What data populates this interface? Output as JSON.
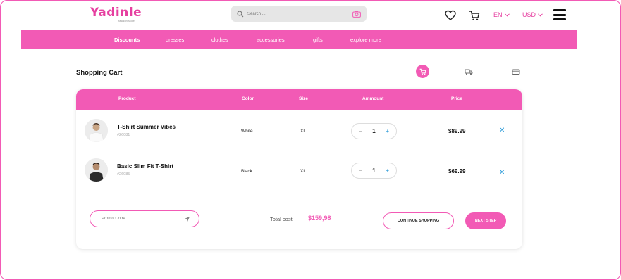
{
  "header": {
    "logo_text": "Yadinle",
    "logo_tagline": "fashion store",
    "search_placeholder": "Search ...",
    "language": "EN",
    "currency": "USD"
  },
  "nav": {
    "items": [
      "Discounts",
      "dresses",
      "clothes",
      "accessories",
      "gifts",
      "explore  more"
    ]
  },
  "page": {
    "title": "Shopping Cart"
  },
  "table": {
    "columns": [
      "Product",
      "Color",
      "Size",
      "Ammount",
      "Price"
    ],
    "rows": [
      {
        "name": "T-Shirt Summer Vibes",
        "sku": "#26081",
        "color": "White",
        "size": "XL",
        "qty": "1",
        "price": "$89.99"
      },
      {
        "name": "Basic Slim Fit T-Shirt",
        "sku": "#26085",
        "color": "Black",
        "size": "XL",
        "qty": "1",
        "price": "$69.99"
      }
    ]
  },
  "footer": {
    "promo_placeholder": "Promo Code",
    "total_label": "Total cost",
    "total_value": "$159,98",
    "continue_label": "CONTINUE SHOPPING",
    "next_label": "NEXT STEP"
  },
  "colors": {
    "accent": "#f25ab5",
    "link": "#2a9ad8"
  }
}
